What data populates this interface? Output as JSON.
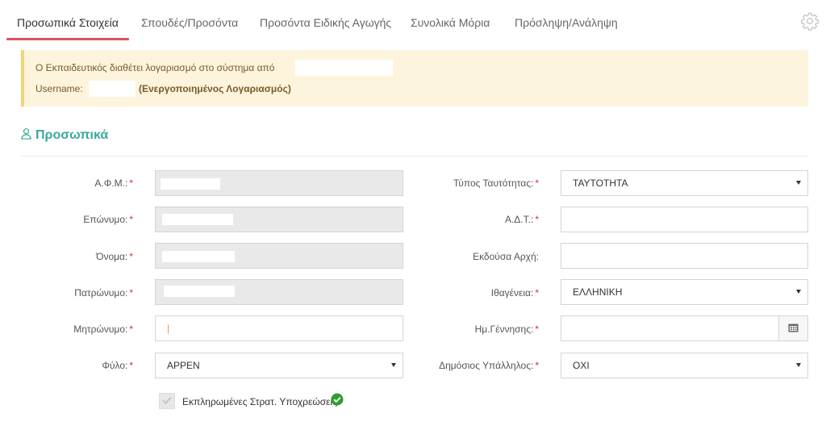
{
  "tabs": [
    {
      "label": "Προσωπικά Στοιχεία",
      "active": true
    },
    {
      "label": "Σπουδές/Προσόντα"
    },
    {
      "label": "Προσόντα Ειδικής Αγωγής"
    },
    {
      "label": "Συνολικά Μόρια"
    },
    {
      "label": "Πρόσληψη/Ανάληψη"
    }
  ],
  "icons": {
    "settings": "gear-icon",
    "section": "user-icon",
    "calendar": "calendar-icon",
    "check": "check-icon",
    "verified": "check-circle-icon",
    "dropdown": "caret-down-icon"
  },
  "alert": {
    "line1_text": "Ο Εκπαιδευτικός διαθέτει λογαριασμό στο σύστημα από",
    "username_label": "Username:",
    "status_text": "(Ενεργοποιημένος Λογαριασμός)"
  },
  "section": {
    "title": "Προσωπικά"
  },
  "form": {
    "required_mark": "*",
    "afm_label": "Α.Φ.Μ.:",
    "surname_label": "Επώνυμο:",
    "name_label": "Όνομα:",
    "father_label": "Πατρώνυμο:",
    "mother_label": "Μητρώνυμο:",
    "gender_label": "Φύλο:",
    "gender_value": "ΑΡΡΕΝ",
    "id_type_label": "Τύπος Ταυτότητας:",
    "id_type_value": "ΤΑΥΤΟΤΗΤΑ",
    "adt_label": "Α.Δ.Τ.:",
    "issuer_label": "Εκδούσα Αρχή:",
    "nationality_label": "Ιθαγένεια:",
    "nationality_value": "ΕΛΛΗΝΙΚΗ",
    "birthdate_label": "Ημ.Γέννησης:",
    "civil_servant_label": "Δημόσιος Υπάλληλος:",
    "civil_servant_value": "ΟΧΙ",
    "military_label": "Εκπληρωμένες Στρατ. Υποχρεώσεις",
    "mother_cursor": "|"
  },
  "colors": {
    "accent": "#3aa89a",
    "tab_active_underline": "#e0525c",
    "alert_bg": "#fcf4dc",
    "alert_border": "#f5d27a",
    "required": "#e02a2a",
    "verified": "#2e9e2e"
  }
}
